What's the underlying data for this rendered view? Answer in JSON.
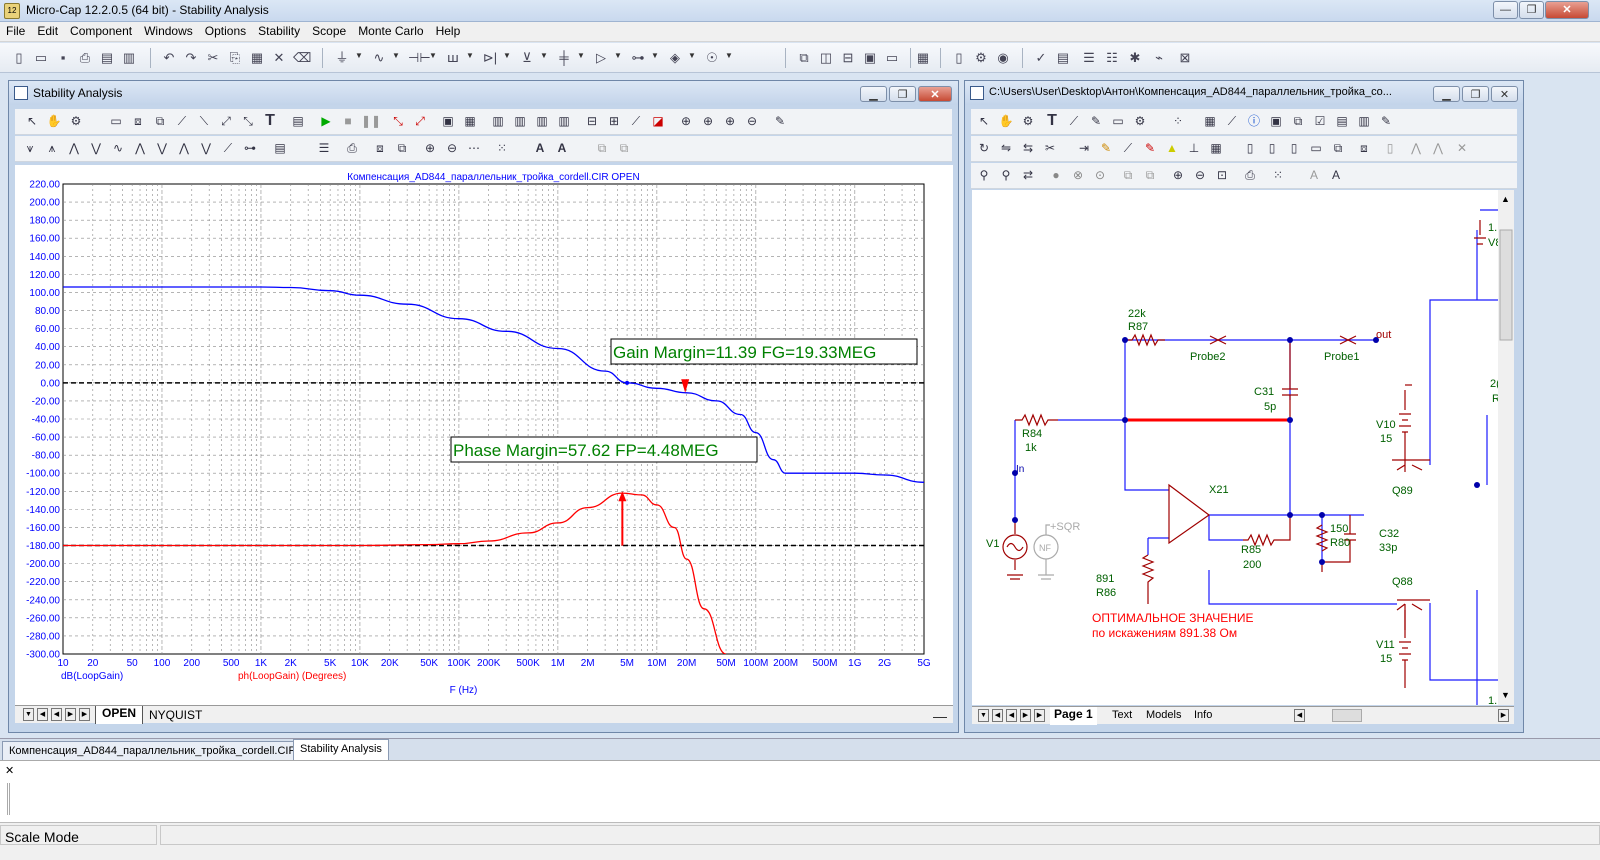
{
  "window": {
    "title": "Micro-Cap 12.2.0.5 (64 bit) - Stability Analysis",
    "app_icon": "12"
  },
  "menu": [
    "File",
    "Edit",
    "Component",
    "Windows",
    "Options",
    "Stability",
    "Scope",
    "Monte Carlo",
    "Help"
  ],
  "stability_window": {
    "title": "Stability Analysis",
    "plot_title": "Компенсация_AD844_параллельник_тройка_cordell.CIR OPEN",
    "gain_margin_label": "Gain Margin=11.39 FG=19.33MEG",
    "phase_margin_label": "Phase Margin=57.62 FP=4.48MEG",
    "legend_gain": "dB(LoopGain)",
    "legend_phase": "ph(LoopGain) (Degrees)",
    "xlabel": "F (Hz)",
    "tabs": [
      "OPEN",
      "NYQUIST"
    ]
  },
  "schematic_window": {
    "title": "C:\\Users\\User\\Desktop\\Антон\\Компенсация_AD844_параллельник_тройка_co...",
    "tabs": [
      "Page 1",
      "Text",
      "Models",
      "Info"
    ],
    "labels": {
      "r87_val": "22k",
      "r87": "R87",
      "probe2": "Probe2",
      "probe1": "Probe1",
      "out": "out",
      "c31": "C31",
      "c31_val": "5p",
      "r84": "R84",
      "r84_val": "1k",
      "in": "In",
      "x21": "X21",
      "v10": "V10",
      "v10_val": "15",
      "q89": "Q89",
      "v1": "V1",
      "sqr": "+SQR",
      "nf": "NF",
      "r80_val": "150",
      "r80": "R80",
      "c32": "C32",
      "c32_val": "33p",
      "r85": "R85",
      "r85_val": "200",
      "r86_val": "891",
      "r86": "R86",
      "q88": "Q88",
      "v11": "V11",
      "v11_val": "15",
      "note1": "ОПТИМАЛЬНОЕ ЗНАЧЕНИЕ",
      "note2": "по искажениям  891.38 Ом",
      "edge1": "1.:",
      "edge2": "V8",
      "edge3": "2(",
      "edge4": "R",
      "edge5": "1."
    }
  },
  "doc_tabs": [
    "Компенсация_AD844_параллельник_тройка_cordell.CIR",
    "Stability Analysis"
  ],
  "status": {
    "mode": "Scale Mode"
  },
  "colors": {
    "gain": "#0000ff",
    "phase": "#ff0000",
    "margin_box": "#008000",
    "schematic": "#a00000",
    "wire": "#1a1aff"
  },
  "chart_data": {
    "type": "line",
    "title": "Компенсация_AD844_параллельник_тройка_cordell.CIR OPEN",
    "xlabel": "F (Hz)",
    "ylabel": "",
    "xscale": "log",
    "xlim": [
      10,
      5000000000
    ],
    "ylim": [
      -300,
      220
    ],
    "x_ticks": [
      {
        "v": 10,
        "t": "10"
      },
      {
        "v": 20,
        "t": "20"
      },
      {
        "v": 50,
        "t": "50"
      },
      {
        "v": 100,
        "t": "100"
      },
      {
        "v": 200,
        "t": "200"
      },
      {
        "v": 500,
        "t": "500"
      },
      {
        "v": 1000,
        "t": "1K"
      },
      {
        "v": 2000,
        "t": "2K"
      },
      {
        "v": 5000,
        "t": "5K"
      },
      {
        "v": 10000,
        "t": "10K"
      },
      {
        "v": 20000,
        "t": "20K"
      },
      {
        "v": 50000,
        "t": "50K"
      },
      {
        "v": 100000,
        "t": "100K"
      },
      {
        "v": 200000,
        "t": "200K"
      },
      {
        "v": 500000,
        "t": "500K"
      },
      {
        "v": 1000000,
        "t": "1M"
      },
      {
        "v": 2000000,
        "t": "2M"
      },
      {
        "v": 5000000,
        "t": "5M"
      },
      {
        "v": 10000000,
        "t": "10M"
      },
      {
        "v": 20000000,
        "t": "20M"
      },
      {
        "v": 50000000,
        "t": "50M"
      },
      {
        "v": 100000000,
        "t": "100M"
      },
      {
        "v": 200000000,
        "t": "200M"
      },
      {
        "v": 500000000,
        "t": "500M"
      },
      {
        "v": 1000000000,
        "t": "1G"
      },
      {
        "v": 2000000000,
        "t": "2G"
      },
      {
        "v": 5000000000,
        "t": "5G"
      }
    ],
    "y_ticks": [
      "220.00",
      "200.00",
      "180.00",
      "160.00",
      "140.00",
      "120.00",
      "100.00",
      "80.00",
      "60.00",
      "40.00",
      "20.00",
      "0.00",
      "-20.00",
      "-40.00",
      "-60.00",
      "-80.00",
      "-100.00",
      "-120.00",
      "-140.00",
      "-160.00",
      "-180.00",
      "-200.00",
      "-220.00",
      "-240.00",
      "-260.00",
      "-280.00",
      "-300.00"
    ],
    "grid": true,
    "series": [
      {
        "name": "dB(LoopGain)",
        "color": "#0000ff",
        "x": [
          10,
          1000,
          2000,
          5000,
          10000,
          30000,
          100000,
          300000,
          1000000,
          3000000,
          5000000,
          10000000,
          20000000,
          40000000,
          70000000,
          100000000,
          150000000,
          200000000,
          300000000,
          1000000000,
          2000000000,
          5000000000
        ],
        "y": [
          106,
          106,
          105.5,
          102,
          97,
          87,
          71,
          57,
          38,
          13,
          0,
          -6,
          -11,
          -20,
          -35,
          -55,
          -85,
          -100,
          -100,
          -100,
          -102,
          -110
        ]
      },
      {
        "name": "ph(LoopGain) (Degrees)",
        "color": "#ff0000",
        "x": [
          10,
          10000,
          50000,
          100000,
          200000,
          500000,
          1000000,
          2000000,
          4480000,
          7000000,
          10000000,
          15000000,
          20000000,
          30000000,
          50000000
        ],
        "y": [
          -180,
          -180,
          -179,
          -178,
          -175,
          -166,
          -155,
          -138,
          -122,
          -124,
          -135,
          -160,
          -195,
          -250,
          -300
        ]
      }
    ],
    "reference_lines": [
      0,
      -180
    ],
    "annotations": [
      {
        "text": "Gain Margin=11.39 FG=19.33MEG"
      },
      {
        "text": "Phase Margin=57.62 FP=4.48MEG"
      }
    ]
  }
}
